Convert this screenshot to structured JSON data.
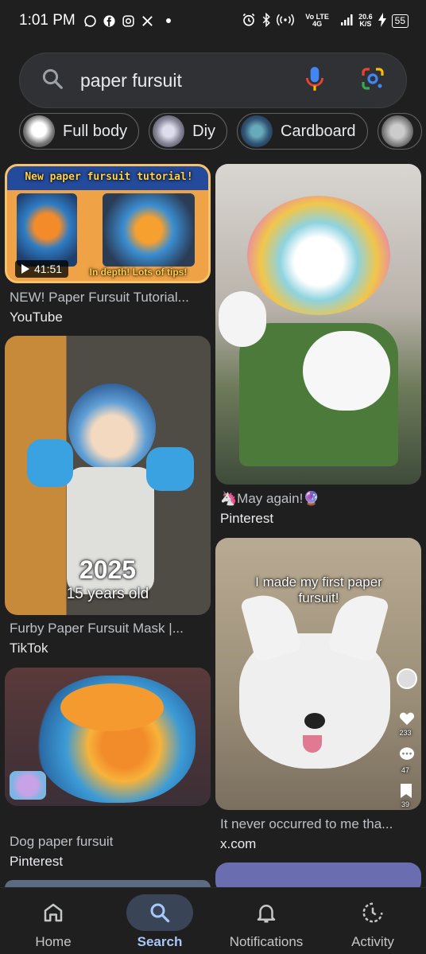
{
  "status": {
    "time": "1:01 PM",
    "network": "Vo LTE 4G",
    "speed_value": "20.6",
    "speed_unit": "K/S",
    "battery": "55"
  },
  "search": {
    "query": "paper fursuit"
  },
  "chips": [
    {
      "label": "Full body"
    },
    {
      "label": "Diy"
    },
    {
      "label": "Cardboard"
    }
  ],
  "results": [
    {
      "title": "NEW! Paper Fursuit Tutorial...",
      "source": "YouTube",
      "overlay_top": "New paper fursuit tutorial!",
      "overlay_bottom": "In depth! Lots of tips!",
      "duration": "41:51"
    },
    {
      "title": "May again!",
      "source": "Pinterest"
    },
    {
      "title": "Furby Paper Fursuit Mask |...",
      "source": "TikTok",
      "overlay_year": "2025",
      "overlay_age": "15 years old"
    },
    {
      "title": "It never occurred to me tha...",
      "source": "x.com",
      "overlay_text": "I made my first paper fursuit!",
      "likes": "233",
      "comments": "47",
      "saves": "39"
    },
    {
      "title": "Dog paper fursuit",
      "source": "Pinterest"
    }
  ],
  "nav": [
    {
      "label": "Home",
      "icon": "home-icon"
    },
    {
      "label": "Search",
      "icon": "search-icon",
      "active": true
    },
    {
      "label": "Notifications",
      "icon": "bell-icon"
    },
    {
      "label": "Activity",
      "icon": "activity-icon"
    }
  ]
}
